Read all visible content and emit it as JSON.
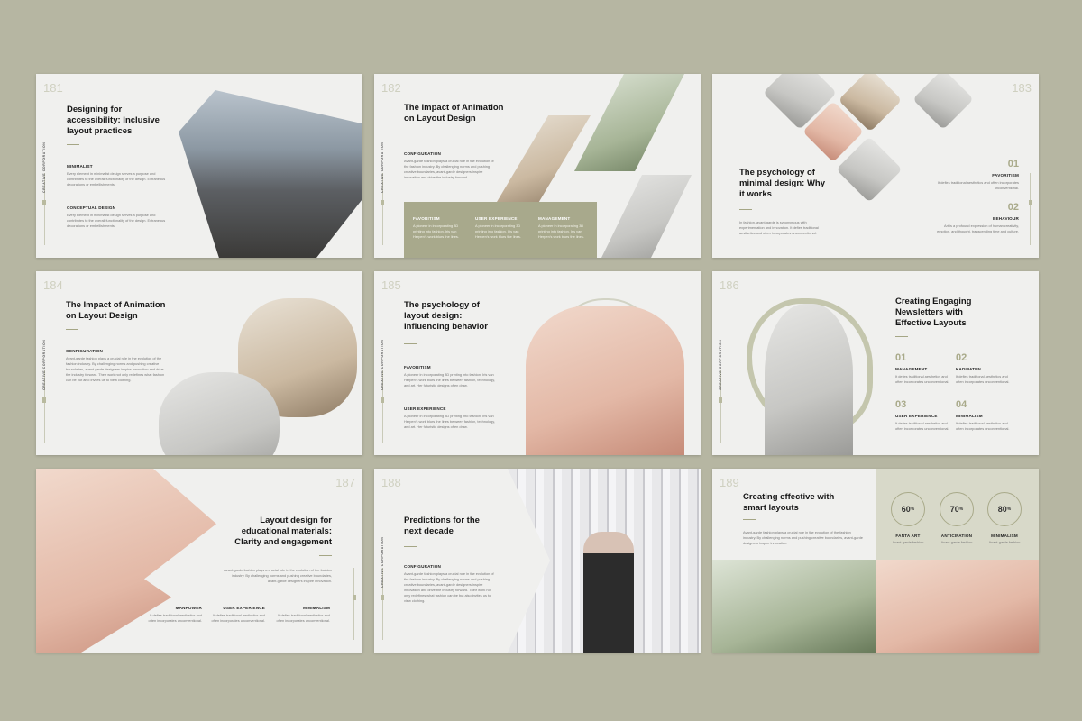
{
  "vertical_label": "CREATIVE CORPORATION",
  "slides": {
    "s181": {
      "num": "181",
      "title": "Designing for accessibility: Inclusive layout practices",
      "items": [
        {
          "label": "MINIMALIST",
          "text": "Every element in minimalist design serves a purpose and contributes to the overall functionality of the design. Extraneous decorations or embellishments."
        },
        {
          "label": "CONCEPTUAL DESIGN",
          "text": "Every element in minimalist design serves a purpose and contributes to the overall functionality of the design. Extraneous decorations or embellishments."
        }
      ]
    },
    "s182": {
      "num": "182",
      "title": "The Impact of Animation on Layout Design",
      "label": "CONFIGURATION",
      "text": "Avant-garde fashion plays a crucial role in the evolution of the fashion industry. By challenging norms and pushing creative boundaries, avant-garde designers inspire innovation and drive the industry forward.",
      "columns": [
        {
          "label": "FAVORITISM",
          "text": "A pioneer in incorporating 3D printing into fashion, Iris van Herpen's work blurs the lines."
        },
        {
          "label": "USER EXPERIENCE",
          "text": "A pioneer in incorporating 3D printing into fashion, Iris van Herpen's work blurs the lines."
        },
        {
          "label": "MANAGEMENT",
          "text": "A pioneer in incorporating 3D printing into fashion, Iris van Herpen's work blurs the lines."
        }
      ]
    },
    "s183": {
      "num": "183",
      "title": "The psychology of minimal design: Why it works",
      "text": "In fashion, avant-garde is synonymous with experimentation and innovation. It defies traditional aesthetics and often incorporates unconventional.",
      "items": [
        {
          "num": "01",
          "label": "FAVORITISM",
          "text": "It defies traditional aesthetics and often incorporates unconventional."
        },
        {
          "num": "02",
          "label": "BEHAVIOUR",
          "text": "Art is a profound expression of human creativity, emotion, and thought, transcending time and culture."
        }
      ]
    },
    "s184": {
      "num": "184",
      "title": "The Impact of Animation on Layout Design",
      "label": "CONFIGURATION",
      "text": "Avant-garde fashion plays a crucial role in the evolution of the fashion industry. By challenging norms and pushing creative boundaries, avant-garde designers inspire innovation and drive the industry forward. Their work not only redefines what fashion can be but also invites us to view clothing."
    },
    "s185": {
      "num": "185",
      "title": "The psychology of layout design: Influencing behavior",
      "items": [
        {
          "label": "FAVORITISM",
          "text": "A pioneer in incorporating 3D printing into fashion, Iris van Herpen's work blurs the lines between fashion, technology, and art. Her futuristic designs often draw."
        },
        {
          "label": "USER EXPERIENCE",
          "text": "A pioneer in incorporating 3D printing into fashion, Iris van Herpen's work blurs the lines between fashion, technology, and art. Her futuristic designs often draw."
        }
      ]
    },
    "s186": {
      "num": "186",
      "title": "Creating Engaging Newsletters with Effective Layouts",
      "items": [
        {
          "num": "01",
          "label": "MANAGEMENT",
          "text": "It defies traditional aesthetics and often incorporates unconventional."
        },
        {
          "num": "02",
          "label": "KADIPATEN",
          "text": "It defies traditional aesthetics and often incorporates unconventional."
        },
        {
          "num": "03",
          "label": "USER EXPERIENCE",
          "text": "It defies traditional aesthetics and often incorporates unconventional."
        },
        {
          "num": "04",
          "label": "MINIMALISM",
          "text": "It defies traditional aesthetics and often incorporates unconventional."
        }
      ]
    },
    "s187": {
      "num": "187",
      "title": "Layout design for educational materials: Clarity and engagement",
      "text": "Avant-garde fashion plays a crucial role in the evolution of the fashion industry. By challenging norms and pushing creative boundaries, avant-garde designers inspire innovation.",
      "items": [
        {
          "label": "MANPOWER",
          "text": "It defies traditional aesthetics and often incorporates unconventional."
        },
        {
          "label": "USER EXPERIENCE",
          "text": "It defies traditional aesthetics and often incorporates unconventional."
        },
        {
          "label": "MINIMALISM",
          "text": "It defies traditional aesthetics and often incorporates unconventional."
        }
      ]
    },
    "s188": {
      "num": "188",
      "title": "Predictions for the next decade",
      "label": "CONFIGURATION",
      "text": "Avant-garde fashion plays a crucial role in the evolution of the fashion industry. By challenging norms and pushing creative boundaries, avant-garde designers inspire innovation and drive the industry forward. Their work not only redefines what fashion can be but also invites us to view clothing."
    },
    "s189": {
      "num": "189",
      "title": "Creating effective with smart layouts",
      "text": "Avant-garde fashion plays a crucial role in the evolution of the fashion industry. By challenging norms and pushing creative boundaries, avant-garde designers inspire innovation.",
      "stats": [
        {
          "value": "60",
          "unit": "%",
          "label": "FANTA ART",
          "sub": "Avant-garde fashion"
        },
        {
          "value": "70",
          "unit": "%",
          "label": "ANTICIPATION",
          "sub": "Avant-garde fashion"
        },
        {
          "value": "80",
          "unit": "%",
          "label": "MINIMALISM",
          "sub": "Avant-garde fashion"
        }
      ]
    }
  }
}
